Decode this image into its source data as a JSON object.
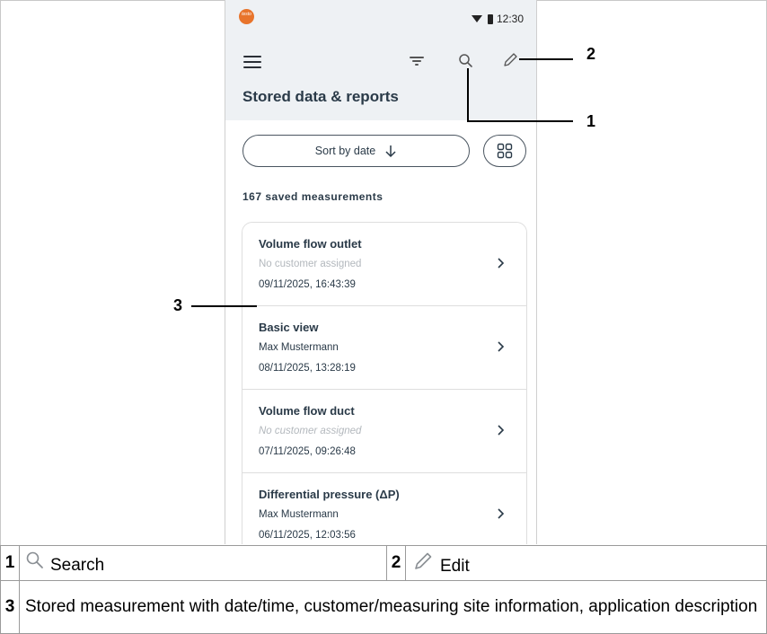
{
  "status_bar": {
    "logo_text": "testo",
    "time": "12:30"
  },
  "header": {
    "title": "Stored data & reports",
    "icons": [
      "menu-icon",
      "filter-icon",
      "search-icon",
      "edit-icon"
    ]
  },
  "toolbar": {
    "sort_label": "Sort by date",
    "sort_icon": "arrow-down-icon",
    "view_icon": "grid-icon"
  },
  "list": {
    "count_label": "167 saved measurements",
    "items": [
      {
        "title": "Volume flow outlet",
        "customer": "No customer assigned",
        "date": "09/11/2025, 16:43:39"
      },
      {
        "title": "Basic view",
        "customer": "Max Mustermann",
        "date": "08/11/2025, 13:28:19"
      },
      {
        "title": "Volume flow duct",
        "customer": "No customer assigned",
        "date": "07/11/2025, 09:26:48"
      },
      {
        "title": "Differential pressure (ΔP)",
        "customer": "Max Mustermann",
        "date": "06/11/2025, 12:03:56"
      }
    ]
  },
  "callouts": {
    "one": "1",
    "two": "2",
    "three": "3"
  },
  "legend": {
    "rows": [
      {
        "num1": "1",
        "label1": "Search",
        "num2": "2",
        "label2": "Edit"
      },
      {
        "num": "3",
        "text": "Stored measurement with date/time, customer/measuring site information, application description"
      }
    ]
  },
  "colors": {
    "header_bg": "#eef1f4",
    "text_primary": "#2a3a48",
    "text_muted": "#b3b8bd",
    "logo": "#e8742b"
  }
}
